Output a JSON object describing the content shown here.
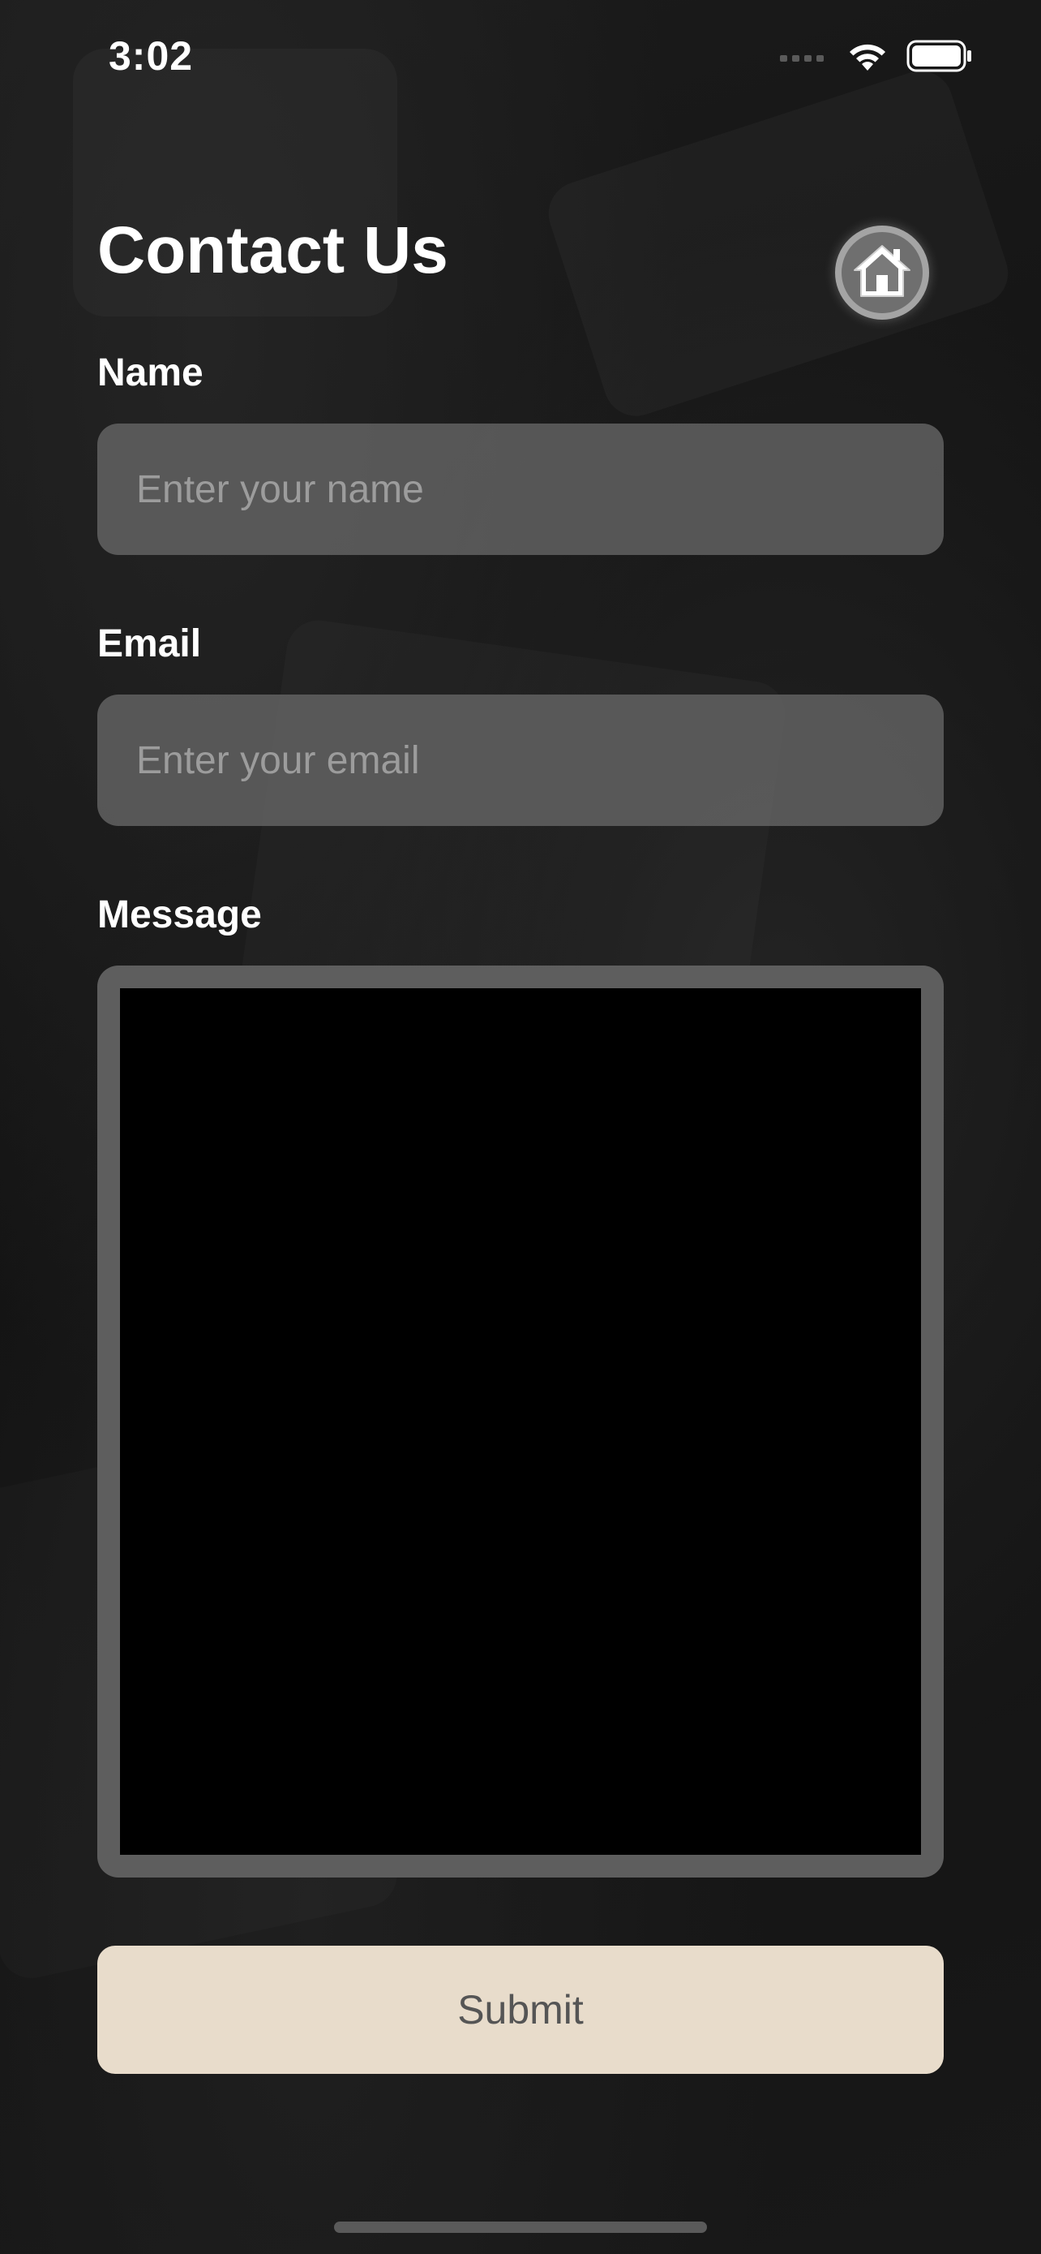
{
  "status_bar": {
    "time": "3:02",
    "icons": [
      "cellular-signal-icon",
      "wifi-icon",
      "battery-icon"
    ]
  },
  "header": {
    "title": "Contact Us",
    "home_icon": "house-icon"
  },
  "form": {
    "name": {
      "label": "Name",
      "value": "",
      "placeholder": "Enter your name"
    },
    "email": {
      "label": "Email",
      "value": "",
      "placeholder": "Enter your email"
    },
    "message": {
      "label": "Message",
      "value": ""
    },
    "submit_label": "Submit"
  },
  "colors": {
    "background": "#151515",
    "input_fill": "#6e6e6e",
    "placeholder": "#9c9c9c",
    "message_border": "#5e5e5e",
    "submit_fill": "#e8dccb",
    "submit_text": "#555555",
    "text": "#ffffff"
  }
}
